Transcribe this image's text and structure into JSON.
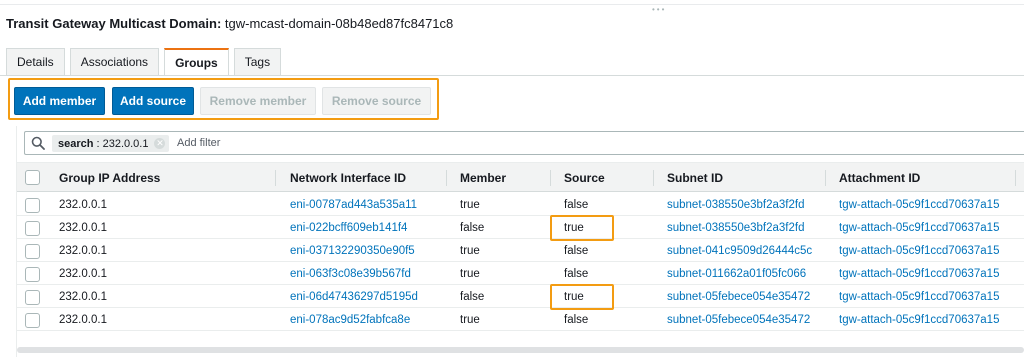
{
  "header": {
    "title_label": "Transit Gateway Multicast Domain:",
    "title_value": "tgw-mcast-domain-08b48ed87fc8471c8"
  },
  "tabs": [
    {
      "label": "Details",
      "active": false
    },
    {
      "label": "Associations",
      "active": false
    },
    {
      "label": "Groups",
      "active": true
    },
    {
      "label": "Tags",
      "active": false
    }
  ],
  "actions": {
    "add_member": "Add member",
    "add_source": "Add source",
    "remove_member": "Remove member",
    "remove_source": "Remove source"
  },
  "filter": {
    "token_key": "search",
    "token_value": ": 232.0.0.1",
    "placeholder": "Add filter"
  },
  "table": {
    "columns": [
      "Group IP Address",
      "Network Interface ID",
      "Member",
      "Source",
      "Subnet ID",
      "Attachment ID"
    ],
    "rows": [
      {
        "group_ip": "232.0.0.1",
        "eni": "eni-00787ad443a535a11",
        "member": "true",
        "source": "false",
        "subnet": "subnet-038550e3bf2a3f2fd",
        "attachment": "tgw-attach-05c9f1ccd70637a15",
        "source_highlight": false
      },
      {
        "group_ip": "232.0.0.1",
        "eni": "eni-022bcff609eb141f4",
        "member": "false",
        "source": "true",
        "subnet": "subnet-038550e3bf2a3f2fd",
        "attachment": "tgw-attach-05c9f1ccd70637a15",
        "source_highlight": true
      },
      {
        "group_ip": "232.0.0.1",
        "eni": "eni-037132290350e90f5",
        "member": "true",
        "source": "false",
        "subnet": "subnet-041c9509d26444c5c",
        "attachment": "tgw-attach-05c9f1ccd70637a15",
        "source_highlight": false
      },
      {
        "group_ip": "232.0.0.1",
        "eni": "eni-063f3c08e39b567fd",
        "member": "true",
        "source": "false",
        "subnet": "subnet-011662a01f05fc066",
        "attachment": "tgw-attach-05c9f1ccd70637a15",
        "source_highlight": false
      },
      {
        "group_ip": "232.0.0.1",
        "eni": "eni-06d47436297d5195d",
        "member": "false",
        "source": "true",
        "subnet": "subnet-05febece054e35472",
        "attachment": "tgw-attach-05c9f1ccd70637a15",
        "source_highlight": true
      },
      {
        "group_ip": "232.0.0.1",
        "eni": "eni-078ac9d52fabfca8e",
        "member": "true",
        "source": "false",
        "subnet": "subnet-05febece054e35472",
        "attachment": "tgw-attach-05c9f1ccd70637a15",
        "source_highlight": false
      }
    ]
  },
  "colors": {
    "primary_button": "#0073bb",
    "link": "#0073bb",
    "highlight": "#f39c12",
    "active_tab_accent": "#ec7211"
  }
}
